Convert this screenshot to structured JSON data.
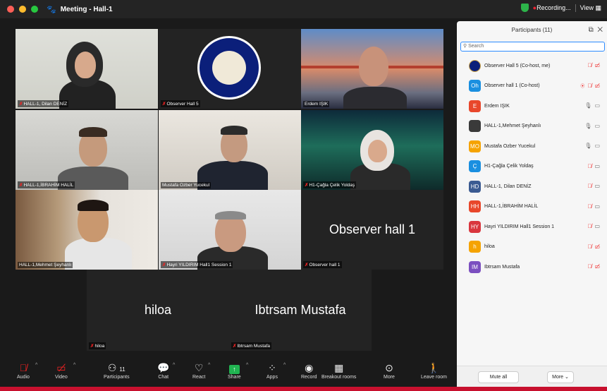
{
  "window": {
    "title": "Meeting - Hall-1"
  },
  "status": {
    "recording": "Recording...",
    "view": "View"
  },
  "tiles": [
    {
      "name": "HALL-1, Dilan DENİZ",
      "muted": true
    },
    {
      "name": "Observer Hall 5",
      "muted": true
    },
    {
      "name": "Erdem IŞIK",
      "muted": false,
      "active": true
    },
    {
      "name": "HALL-1,İBRAHİM HALİL",
      "muted": true
    },
    {
      "name": "Mustafa Ozber Yucekul",
      "muted": false
    },
    {
      "name": "H1-Çağla Çelik Yoldaş",
      "muted": true
    },
    {
      "name": "HALL-1,Mehmet Şeyhanlı",
      "muted": false
    },
    {
      "name": "Hayri YILDIRIM Hall1 Session 1",
      "muted": true
    },
    {
      "name": "Observer hall 1",
      "muted": true,
      "label": "Observer hall 1"
    }
  ],
  "bottom_tiles": [
    {
      "name": "hiloa",
      "label": "hiloa"
    },
    {
      "name": "Ibtrsam Mustafa",
      "label": "Ibtrsam Mustafa"
    }
  ],
  "controls": {
    "audio": "Audio",
    "video": "Video",
    "participants": "Participants",
    "participants_count": "11",
    "chat": "Chat",
    "react": "React",
    "share": "Share",
    "apps": "Apps",
    "record": "Record",
    "breakout": "Breakout rooms",
    "more": "More",
    "leave": "Leave room"
  },
  "panel": {
    "title": "Participants (11)",
    "search_placeholder": "Search",
    "mute_all": "Mute all",
    "more": "More",
    "participants": [
      {
        "name": "Observer Hall 5 (Co-host, me)",
        "initials": "",
        "color": "#0b1f7a"
      },
      {
        "name": "Observer hall 1 (Co-host)",
        "initials": "Oh",
        "color": "#1a8fe0"
      },
      {
        "name": "Erdem IŞIK",
        "initials": "E",
        "color": "#e8472b"
      },
      {
        "name": "HALL-1,Mehmet Şeyhanlı",
        "initials": "",
        "color": "#3a3a3a"
      },
      {
        "name": "Mustafa Ozber Yucekul",
        "initials": "MO",
        "color": "#f5a300"
      },
      {
        "name": "H1-Çağla Çelik Yoldaş",
        "initials": "Ç",
        "color": "#1a8fe0"
      },
      {
        "name": "HALL-1, Dilan DENİZ",
        "initials": "HD",
        "color": "#3b5b92"
      },
      {
        "name": "HALL-1,İBRAHİM HALİL",
        "initials": "HH",
        "color": "#e8472b"
      },
      {
        "name": "Hayri YILDIRIM Hall1 Session 1",
        "initials": "HY",
        "color": "#d9363e"
      },
      {
        "name": "hiloa",
        "initials": "h",
        "color": "#f5a300"
      },
      {
        "name": "Ibtrsam Mustafa",
        "initials": "IM",
        "color": "#7b4fc0"
      }
    ]
  }
}
